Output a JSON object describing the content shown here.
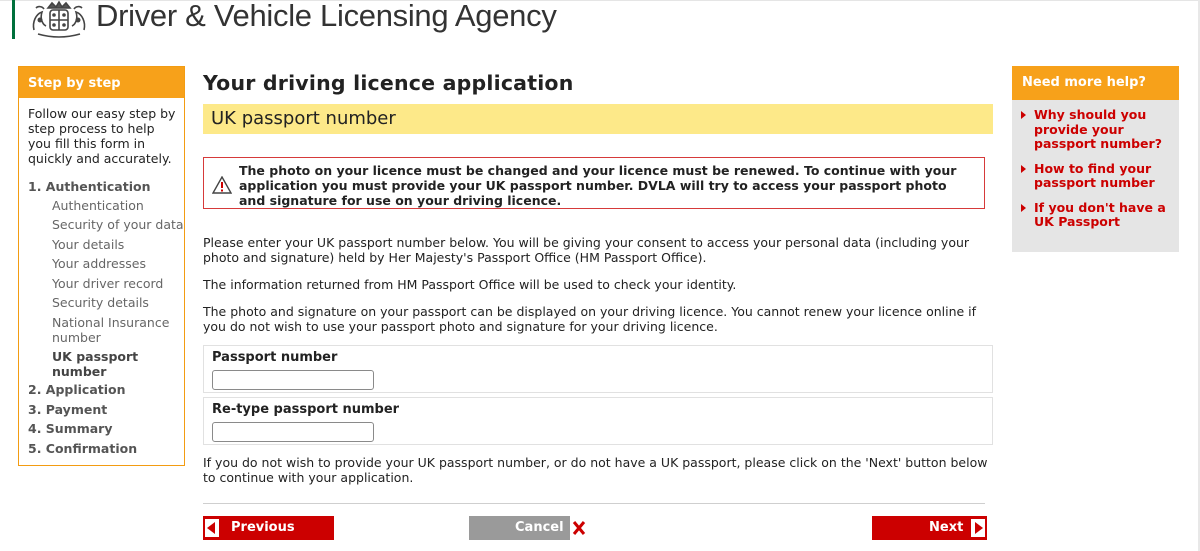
{
  "header": {
    "agency_name": "Driver & Vehicle Licensing Agency",
    "crest_icon": "royal-crest-icon"
  },
  "steps": {
    "title": "Step by step",
    "intro": "Follow our easy step by step process to help you fill this form in quickly and accurately.",
    "sections": [
      {
        "label": "1. Authentication",
        "items": [
          "Authentication",
          "Security of your data",
          "Your details",
          "Your addresses",
          "Your driver record",
          "Security details",
          "National Insurance number",
          "UK passport number"
        ],
        "current_item": "UK passport number"
      },
      {
        "label": "2. Application"
      },
      {
        "label": "3. Payment"
      },
      {
        "label": "4. Summary"
      },
      {
        "label": "5. Confirmation"
      }
    ]
  },
  "main": {
    "title": "Your driving licence application",
    "subtitle": "UK passport number",
    "warning": "The photo on your licence must be changed and your licence must be renewed. To continue with your application you must provide your UK passport number. DVLA will try to access your passport photo and signature for use on your driving licence.",
    "para1": "Please enter your UK passport number below. You will be giving your consent to access your personal data (including your photo and signature) held by Her Majesty's Passport Office (HM Passport Office).",
    "para2": "The information returned from HM Passport Office will be used to check your identity.",
    "para3": "The photo and signature on your passport can be displayed on your driving licence. You cannot renew your licence online if you do not wish to use your passport photo and signature for your driving licence.",
    "passport_label": "Passport number",
    "passport_value": "",
    "retype_label": "Re-type passport number",
    "retype_value": "",
    "para4": "If you do not wish to provide your UK passport number, or do not have a UK passport, please click on the 'Next' button below to continue with your application."
  },
  "buttons": {
    "previous": "Previous",
    "cancel": "Cancel",
    "next": "Next"
  },
  "help": {
    "title": "Need more help?",
    "links": [
      "Why should you provide your passport number?",
      "How to find your passport number",
      "If you don't have a UK Passport"
    ]
  },
  "colors": {
    "accent_orange": "#f7a11a",
    "link_red": "#cc0000",
    "subtitle_yellow": "#fde989",
    "brand_green": "#00703c"
  }
}
